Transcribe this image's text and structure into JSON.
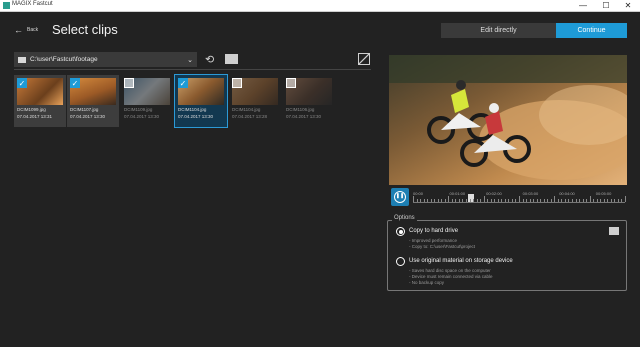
{
  "window": {
    "title": "MAGIX Fastcut",
    "minimize": "—",
    "maximize": "☐",
    "close": "✕"
  },
  "header": {
    "back_icon": "arrow-left",
    "back_label": "Back",
    "title": "Select clips",
    "edit_directly_label": "Edit directly",
    "continue_label": "Continue",
    "accent_color": "#1e9bd7"
  },
  "browser": {
    "path": "C:\\user\\Fastcut\\footage",
    "refresh_icon": "refresh",
    "folder_icon": "folder",
    "no_media_icon": "no-media"
  },
  "clips": [
    {
      "name": "DCIM1099.jpg",
      "date": "07.04.2017 13:31",
      "checked": true,
      "state": "selected"
    },
    {
      "name": "DCIM1107.jpg",
      "date": "07.04.2017 13:30",
      "checked": true,
      "state": "selected"
    },
    {
      "name": "DCIM1109.jpg",
      "date": "07.04.2017 13:30",
      "checked": false,
      "state": "unselected"
    },
    {
      "name": "DCIM1104.jpg",
      "date": "07.04.2017 13:30",
      "checked": true,
      "state": "active"
    },
    {
      "name": "DCIM1104.jpg",
      "date": "07.04.2017 13:28",
      "checked": false,
      "state": "unselected"
    },
    {
      "name": "DCIM1106.jpg",
      "date": "07.04.2017 13:30",
      "checked": false,
      "state": "unselected"
    }
  ],
  "player": {
    "pause_icon": "pause",
    "timeline_labels": [
      "00:00",
      "00:01:00",
      "00:02:00",
      "00:03:00",
      "00:04:00",
      "00:05:00"
    ],
    "position": 0.26
  },
  "options": {
    "legend": "Options",
    "copy": {
      "title": "Copy to hard drive",
      "lines": [
        "- Improved performance",
        "- Copy to: C:\\user\\Fastcut\\project"
      ],
      "selected": true
    },
    "original": {
      "title": "Use original material on storage device",
      "lines": [
        "- Saves hard disc space on the computer",
        "- Device must remain connected via cable",
        "- No backup copy"
      ],
      "selected": false
    }
  }
}
